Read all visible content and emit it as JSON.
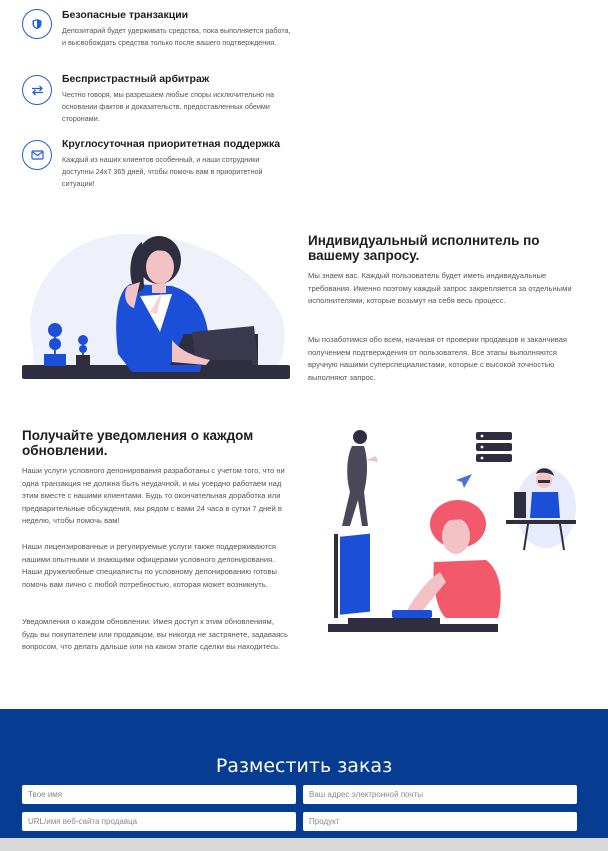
{
  "features": [
    {
      "title": "Безопасные транзакции",
      "text": "Депозитарий будет удерживать средства, пока выполняется работа, и высвобождать средства только после вашего подтверждения.",
      "icon": "shield-icon"
    },
    {
      "title": "Беспристрастный арбитраж",
      "text": "Честно говоря, мы разрешаем любые споры исключительно на основании фактов и доказательств, предоставленных обеими сторонами.",
      "icon": "exchange-arrows-icon"
    },
    {
      "title": "Круглосуточная приоритетная поддержка",
      "text": "Каждый из наших клиентов особенный, и наши сотрудники доступны 24x7 365 дней, чтобы помочь вам в приоритетной ситуации!",
      "icon": "envelope-icon"
    }
  ],
  "individual": {
    "title": "Индивидуальный исполнитель по вашему запросу.",
    "p1": "Мы знаем вас. Каждый пользователь будет иметь индивидуальные требования. Именно поэтому каждый запрос закрепляется за отдельными исполнителями, которые возьмут на себя весь процесс.",
    "p2": "Мы позаботимся обо всем, начиная от проверки продавцов и заканчивая получением подтверждения от пользователя. Все этапы выполняются вручную нашими суперспециалистами, которые с высокой точностью выполняют запрос."
  },
  "notifications": {
    "title": "Получайте уведомления о каждом обновлении.",
    "p1": "Наши услуги условного депонирования разработаны с учетом того, что ни одна транзакция не должна быть неудачной, и мы усердно работаем над этим вместе с нашими клиентами. Будь то окончательная доработка или предварительные обсуждения, мы рядом с вами 24 часа в сутки 7 дней в неделю, чтобы помочь вам!",
    "p2": "Наши лицензированные и регулируемые услуги также поддерживаются нашими опытными и знающими офицерами условного депонирования. Наши дружелюбные специалисты по условному депонированию готовы помочь вам лично с любой потребностью, которая может возникнуть.",
    "p3": "Уведомления о каждом обновлении. Имея доступ к этим обновлениям, будь вы покупателем или продавцом, вы никогда не застрянете, задаваясь вопросом, что делать дальше или на каком этапе сделки вы находитесь."
  },
  "order": {
    "title": "Разместить заказ",
    "name_placeholder": "Твое имя",
    "email_placeholder": "Ваш адрес электронной почты",
    "url_placeholder": "URL/имя веб-сайта продавца",
    "product_placeholder": "Продукт"
  },
  "colors": {
    "accent": "#1f5fd6",
    "order_bg": "#063c91",
    "figure_blue": "#1b4fd8",
    "figure_pink": "#f25a6b",
    "figure_dark": "#2f2e41"
  }
}
